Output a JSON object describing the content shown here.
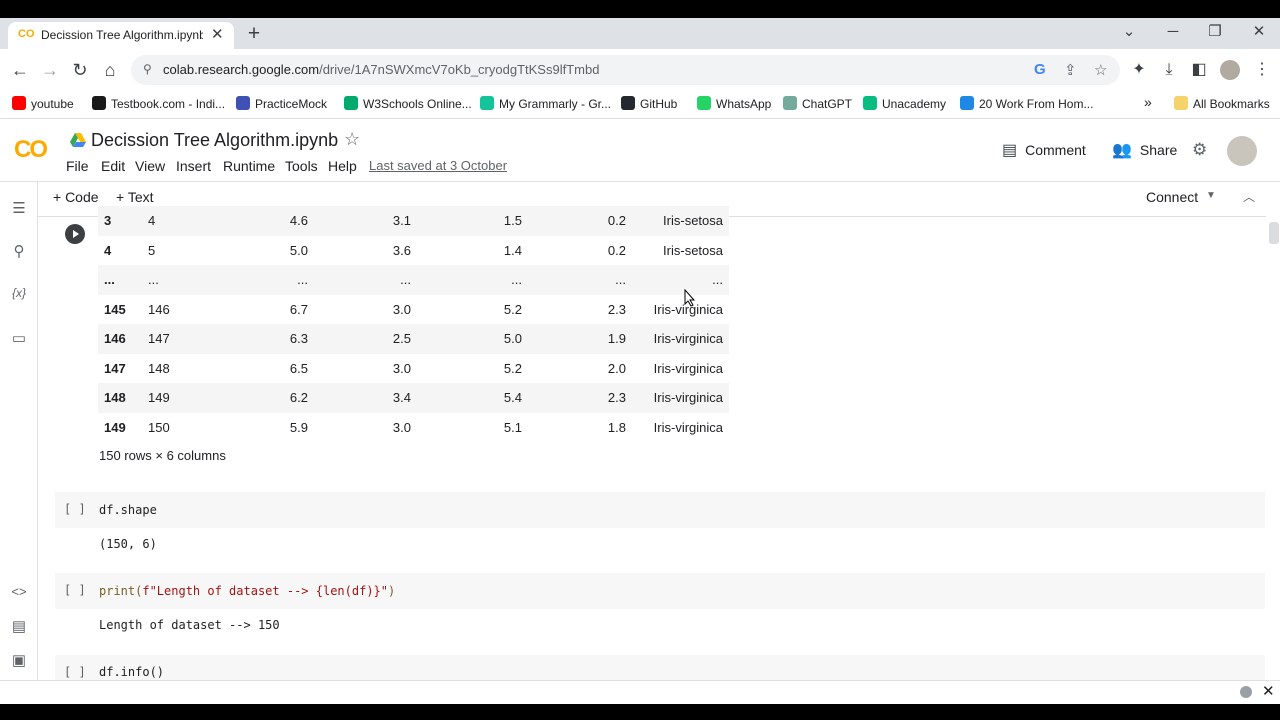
{
  "browser": {
    "tab_title": "Decission Tree Algorithm.ipynb",
    "tab_favicon": "CO",
    "tab_close": "✕",
    "new_tab": "+",
    "window": {
      "chevron": "⌄",
      "minimize": "─",
      "restore": "❐",
      "close": "✕"
    },
    "url_host": "colab.research.google.com",
    "url_path": "/drive/1A7nSWXmcV7oKb_cryodgTtKSs9lfTmbd",
    "bookmarks": [
      {
        "label": "youtube",
        "icon": "youtube-icon",
        "color": "#ff0000"
      },
      {
        "label": "Testbook.com - Indi...",
        "icon": "testbook-icon",
        "color": "#1a1a1a"
      },
      {
        "label": "PracticeMock",
        "icon": "practicemock-icon",
        "color": "#3f51b5"
      },
      {
        "label": "W3Schools Online...",
        "icon": "w3schools-icon",
        "color": "#04aa6d"
      },
      {
        "label": "My Grammarly - Gr...",
        "icon": "grammarly-icon",
        "color": "#15c39a"
      },
      {
        "label": "GitHub",
        "icon": "github-icon",
        "color": "#24292f"
      },
      {
        "label": "WhatsApp",
        "icon": "whatsapp-icon",
        "color": "#25d366"
      },
      {
        "label": "ChatGPT",
        "icon": "chatgpt-icon",
        "color": "#74aa9c"
      },
      {
        "label": "Unacademy",
        "icon": "unacademy-icon",
        "color": "#08bd80"
      },
      {
        "label": "20 Work From Hom...",
        "icon": "wfh-icon",
        "color": "#1e88e5"
      }
    ],
    "bookmarks_overflow": "»",
    "all_bookmarks": "All Bookmarks"
  },
  "colab": {
    "logo": "CO",
    "title": "Decission Tree Algorithm.ipynb",
    "menu": [
      "File",
      "Edit",
      "View",
      "Insert",
      "Runtime",
      "Tools",
      "Help"
    ],
    "last_saved": "Last saved at 3 October",
    "comment": "Comment",
    "share": "Share",
    "add_code": "+ Code",
    "add_text": "+ Text",
    "connect": "Connect",
    "accent": "#f9ab00"
  },
  "table": {
    "rows": [
      {
        "idx": "3",
        "id": "4",
        "a": "4.6",
        "b": "3.1",
        "c": "1.5",
        "d": "0.2",
        "species": "Iris-setosa"
      },
      {
        "idx": "4",
        "id": "5",
        "a": "5.0",
        "b": "3.6",
        "c": "1.4",
        "d": "0.2",
        "species": "Iris-setosa"
      },
      {
        "idx": "...",
        "id": "...",
        "a": "...",
        "b": "...",
        "c": "...",
        "d": "...",
        "species": "..."
      },
      {
        "idx": "145",
        "id": "146",
        "a": "6.7",
        "b": "3.0",
        "c": "5.2",
        "d": "2.3",
        "species": "Iris-virginica"
      },
      {
        "idx": "146",
        "id": "147",
        "a": "6.3",
        "b": "2.5",
        "c": "5.0",
        "d": "1.9",
        "species": "Iris-virginica"
      },
      {
        "idx": "147",
        "id": "148",
        "a": "6.5",
        "b": "3.0",
        "c": "5.2",
        "d": "2.0",
        "species": "Iris-virginica"
      },
      {
        "idx": "148",
        "id": "149",
        "a": "6.2",
        "b": "3.4",
        "c": "5.4",
        "d": "2.3",
        "species": "Iris-virginica"
      },
      {
        "idx": "149",
        "id": "150",
        "a": "5.9",
        "b": "3.0",
        "c": "5.1",
        "d": "1.8",
        "species": "Iris-virginica"
      }
    ],
    "note": "150 rows × 6 columns"
  },
  "cells": {
    "bracket": "[ ]",
    "shape_code": "df.shape",
    "shape_out": "(150, 6)",
    "print_prefix": "print(",
    "print_str": "f\"Length of dataset --> {len(df)}\"",
    "print_suffix": ")",
    "print_out": "Length of dataset --> 150",
    "info_code": "df.info()"
  }
}
